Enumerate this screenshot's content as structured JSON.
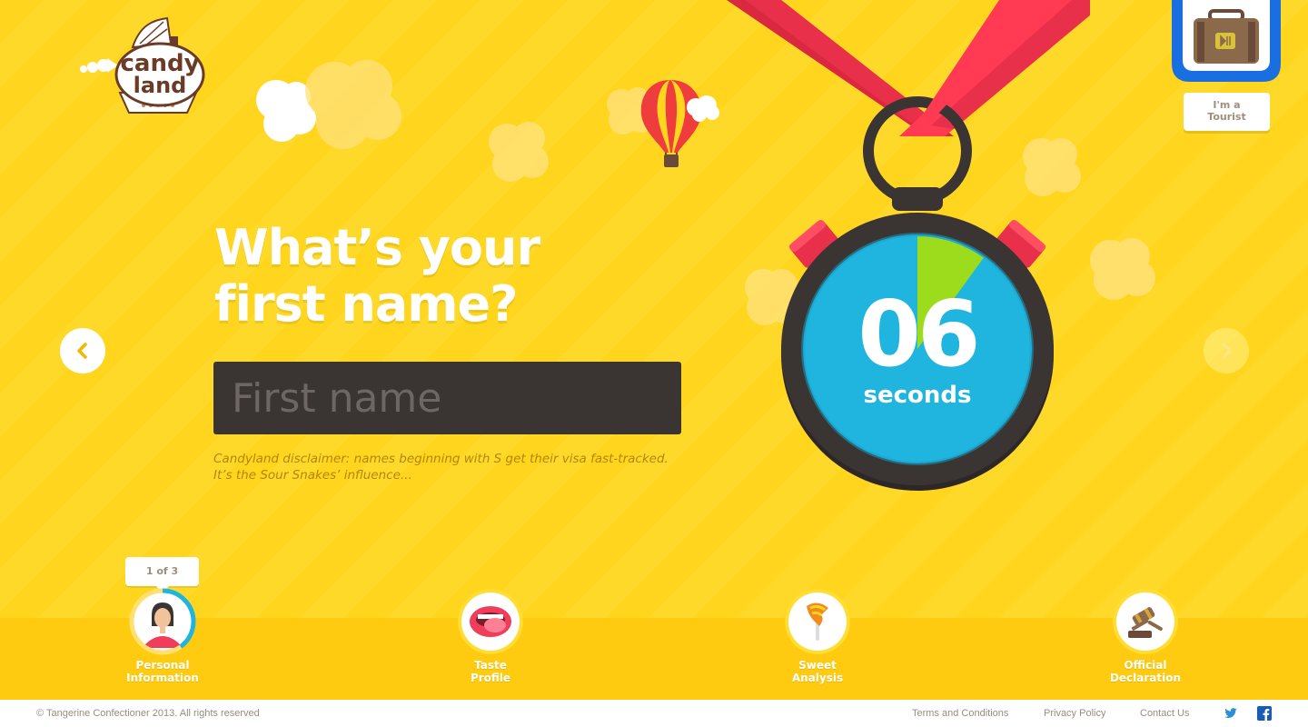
{
  "brand": {
    "name_line1": "candy",
    "name_line2": "land"
  },
  "question": {
    "line1": "What’s your",
    "line2": "first name?"
  },
  "input": {
    "placeholder": "First name"
  },
  "disclaimer": {
    "line1": "Candyland disclaimer: names beginning with S get their visa fast-tracked.",
    "line2": "It’s the Sour Snakes’ influence..."
  },
  "timer": {
    "value": "06",
    "unit": "seconds",
    "remaining_fraction": 0.1
  },
  "tourist": {
    "label_line1": "I'm a",
    "label_line2": "Tourist"
  },
  "progress": {
    "tooltip": "1 of 3",
    "steps": [
      {
        "line1": "Personal",
        "line2": "Information",
        "icon": "person-icon",
        "progress_fraction": 0.4
      },
      {
        "line1": "Taste",
        "line2": "Profile",
        "icon": "mouth-icon"
      },
      {
        "line1": "Sweet",
        "line2": "Analysis",
        "icon": "lollipop-icon"
      },
      {
        "line1": "Official",
        "line2": "Declaration",
        "icon": "gavel-icon"
      }
    ]
  },
  "footer": {
    "copyright": "© Tangerine Confectioner 2013. All rights reserved",
    "links": [
      "Terms and Conditions",
      "Privacy Policy",
      "Contact Us"
    ]
  },
  "colors": {
    "background": "#ffd51e",
    "input_bg": "#3a3433",
    "stopwatch_face": "#1fb5de",
    "timer_wedge": "#9ddc1c",
    "ribbon": "#e8304a",
    "tourist_frame": "#1a6fe0"
  }
}
